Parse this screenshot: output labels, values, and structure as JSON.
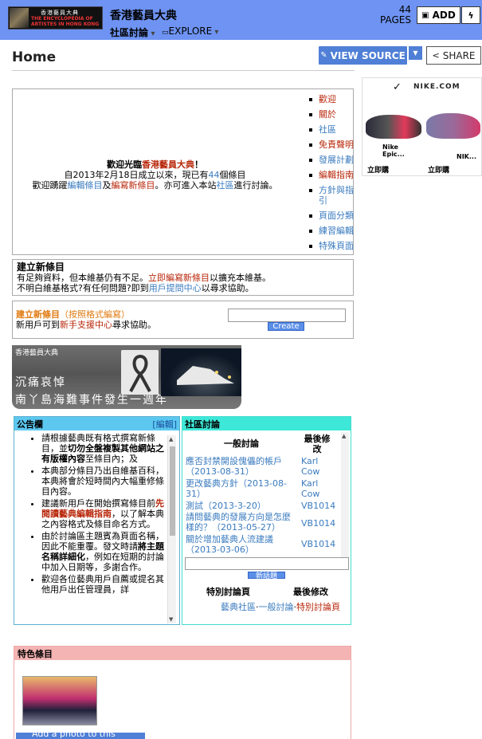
{
  "header": {
    "logo_text_cn": "香港藝員大典",
    "logo_text_en": "THE ENCYCLOPEDIA OF ARTISTES IN HONG KONG",
    "wiki_name": "香港藝員大典",
    "nav_forum": "社區討論",
    "nav_explore": "EXPLORE",
    "pages_count": "44",
    "pages_label": "PAGES",
    "add_label": "ADD"
  },
  "page": {
    "title": "Home",
    "view_source": "VIEW SOURCE",
    "share": "SHARE"
  },
  "ad": {
    "brand": "NIKE.COM",
    "caption1": "立即購",
    "caption2": "立即購",
    "product": "Nike Epic...",
    "product2": "NIK..."
  },
  "welcome": {
    "line1_a": "歡迎光臨",
    "line1_b": "香港藝員大典",
    "line1_c": "！",
    "line2_a": "自2013年2月18日成立以來，現已有",
    "line2_b": "44",
    "line2_c": "個條目",
    "line3_a": "歡迎踴躍",
    "line3_b": "編輯條目",
    "line3_c": "及",
    "line3_d": "編寫新條目",
    "line3_e": "。亦可進入本站",
    "line3_f": "社區",
    "line3_g": "進行討論。",
    "menu": [
      "歡迎",
      "關於",
      "社區",
      "免責聲明",
      "發展計劃",
      "編輯指南",
      "方針與指引",
      "頁面分類",
      "練習編輯",
      "特殊頁面"
    ]
  },
  "create1": {
    "title": "建立新條目",
    "l1_a": "有足夠資料，但本維基仍有不足。",
    "l1_b": "立即編寫新條目",
    "l1_c": "以擴充本維基。",
    "l2_a": "不明白維基格式?有任何問題?即到",
    "l2_b": "用戶提問中心",
    "l2_c": "以尋求協助。"
  },
  "create2": {
    "title_a": "建立新條目",
    "title_b": "（按照格式編寫）",
    "l1_a": "新用戶可到",
    "l1_b": "新手支援中心",
    "l1_c": "尋求協助。",
    "button": "Create"
  },
  "banner": {
    "label": "香港藝員大典",
    "line1": "沉痛哀悼",
    "line2": "南丫島海難事件發生一週年"
  },
  "announce": {
    "title": "公告欄",
    "edit": "[編輯]",
    "items": [
      {
        "a": "請根據藝典既有格式撰寫新條目，並",
        "b": "切勿全盤複製其他網站之有版權內容",
        "c": "至條目內；及"
      },
      {
        "a": "本典部分條目乃出自維基百科，本典將會於短時間內大幅重修條目內容。",
        "b": "",
        "c": ""
      },
      {
        "a": "建議新用戶在開始撰寫條目前",
        "b": "先閱讀藝典編輯指南",
        "c": "，以了解本典之內容格式及條目命名方式。"
      },
      {
        "a": "由於討論區主題賓為頁面名稱，因此不能重覆。發文時請",
        "b": "將主題名稱詳細化",
        "c": "，例如在短期的討論中加入日期等，多謝合作。"
      },
      {
        "a": "歡迎各位藝典用戶自薦或提名其他用戶出任管理員，詳",
        "b": "",
        "c": ""
      }
    ]
  },
  "forum": {
    "title": "社區討論",
    "col_topic": "一般討論",
    "col_last": "最後修改",
    "rows": [
      {
        "topic": "應否封禁開設傀儡的帳戶（2013-08-31）",
        "user": "Karl Cow"
      },
      {
        "topic": "更改藝典方針（2013-08-31）",
        "user": "Karl Cow"
      },
      {
        "topic": "測試（2013-3-20）",
        "user": "VB1014"
      },
      {
        "topic": "請問藝典的發展方向是怎麼樣的？（2013-05-27）",
        "user": "VB1014"
      },
      {
        "topic": "關於增加藝典人流建議（2013-03-06）",
        "user": "VB1014"
      }
    ],
    "new_topic": "新話題",
    "special_col": "特別討論頁",
    "special_last": "最後修改",
    "footer_a": "藝典社區",
    "footer_b": "一般討論",
    "footer_c": "特別討論頁"
  },
  "featured": {
    "title": "特色條目",
    "add_photo": "Add a photo to this gallery"
  }
}
